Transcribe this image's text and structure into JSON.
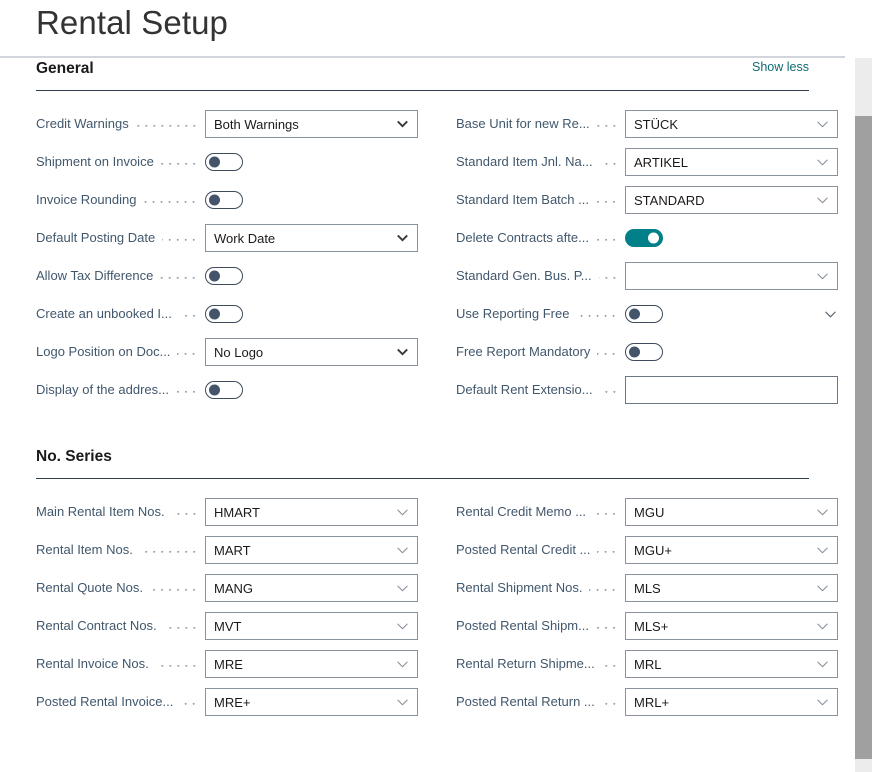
{
  "page": {
    "title": "Rental Setup"
  },
  "scrollbar": {
    "name": "vertical-scrollbar"
  },
  "sections": [
    {
      "id": "general",
      "title": "General",
      "action_label": "Show less",
      "left_fields": [
        {
          "label": "Credit Warnings",
          "type": "select",
          "value": "Both Warnings"
        },
        {
          "label": "Shipment on Invoice",
          "type": "toggle",
          "value": "off"
        },
        {
          "label": "Invoice Rounding",
          "type": "toggle",
          "value": "off"
        },
        {
          "label": "Default Posting Date",
          "type": "select",
          "value": "Work Date"
        },
        {
          "label": "Allow Tax Difference",
          "type": "toggle",
          "value": "off"
        },
        {
          "label": "Create an unbooked I...",
          "type": "toggle",
          "value": "off"
        },
        {
          "label": "Logo Position on Doc...",
          "type": "select",
          "value": "No Logo"
        },
        {
          "label": "Display of the addres...",
          "type": "toggle",
          "value": "off"
        }
      ],
      "right_fields": [
        {
          "label": "Base Unit for new Re...",
          "type": "lookup",
          "value": "STÜCK"
        },
        {
          "label": "Standard Item Jnl. Na...",
          "type": "lookup",
          "value": "ARTIKEL"
        },
        {
          "label": "Standard Item Batch ...",
          "type": "lookup",
          "value": "STANDARD"
        },
        {
          "label": "Delete Contracts afte...",
          "type": "toggle",
          "value": "on"
        },
        {
          "label": "Standard Gen. Bus. P...",
          "type": "lookup",
          "value": ""
        },
        {
          "label": "Use Reporting Free",
          "type": "toggle",
          "value": "off",
          "trailing_chevron": true
        },
        {
          "label": "Free Report Mandatory",
          "type": "toggle",
          "value": "off"
        },
        {
          "label": "Default Rent Extensio...",
          "type": "text",
          "value": ""
        }
      ]
    },
    {
      "id": "no-series",
      "title": "No. Series",
      "action_label": "",
      "left_fields": [
        {
          "label": "Main Rental Item Nos.",
          "type": "lookup",
          "value": "HMART"
        },
        {
          "label": "Rental Item Nos.",
          "type": "lookup",
          "value": "MART"
        },
        {
          "label": "Rental Quote Nos.",
          "type": "lookup",
          "value": "MANG"
        },
        {
          "label": "Rental Contract Nos.",
          "type": "lookup",
          "value": "MVT"
        },
        {
          "label": "Rental Invoice Nos.",
          "type": "lookup",
          "value": "MRE"
        },
        {
          "label": "Posted Rental Invoice...",
          "type": "lookup",
          "value": "MRE+"
        }
      ],
      "right_fields": [
        {
          "label": "Rental Credit Memo ...",
          "type": "lookup",
          "value": "MGU"
        },
        {
          "label": "Posted Rental Credit ...",
          "type": "lookup",
          "value": "MGU+"
        },
        {
          "label": "Rental Shipment Nos.",
          "type": "lookup",
          "value": "MLS"
        },
        {
          "label": "Posted Rental Shipm...",
          "type": "lookup",
          "value": "MLS+"
        },
        {
          "label": "Rental Return Shipme...",
          "type": "lookup",
          "value": "MRL"
        },
        {
          "label": "Posted Rental Return ...",
          "type": "lookup",
          "value": "MRL+"
        }
      ]
    }
  ],
  "colors": {
    "accent_teal": "#018089",
    "link_teal": "#0f6b75",
    "label_blue": "#41576c",
    "rule_dark": "#2f3d4d"
  },
  "icons": {
    "chevron_down": "chevron-down-icon",
    "toggle": "toggle-switch"
  }
}
